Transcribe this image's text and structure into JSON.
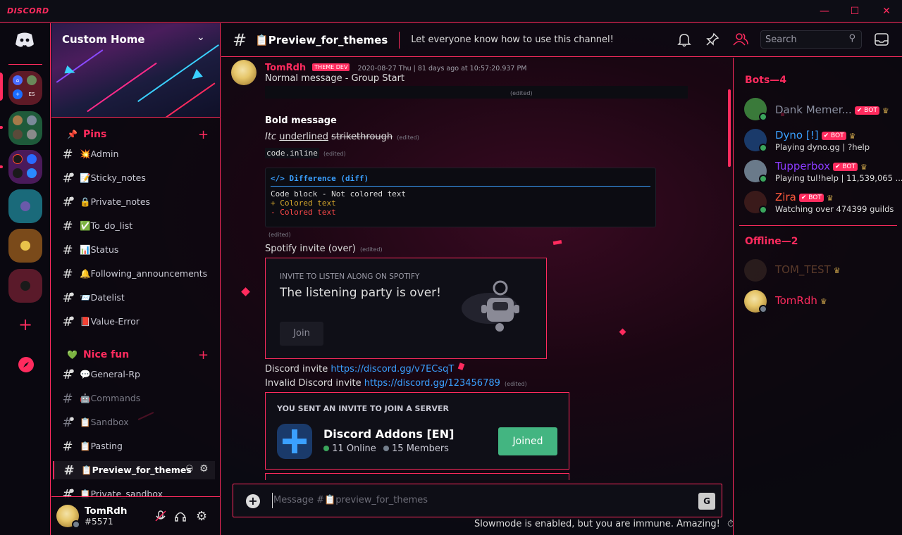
{
  "app": {
    "brand": "DISCORD"
  },
  "window": {
    "minimize": "—",
    "maximize": "☐",
    "close": "✕"
  },
  "server": {
    "name": "Custom Home"
  },
  "guild_mini": {
    "es": "ES"
  },
  "categories": [
    {
      "name": "Pins",
      "icon": "📌"
    },
    {
      "name": "Nice fun",
      "icon": "💚"
    }
  ],
  "channels_pins": [
    {
      "label": "💥Admin",
      "locked": false
    },
    {
      "label": "📝Sticky_notes",
      "locked": true
    },
    {
      "label": "🔒Private_notes",
      "locked": true
    },
    {
      "label": "✅To_do_list",
      "locked": false
    },
    {
      "label": "📊Status",
      "locked": false
    },
    {
      "label": "🔔Following_announcements",
      "locked": false
    },
    {
      "label": "📨Datelist",
      "locked": true
    },
    {
      "label": "📕Value-Error",
      "locked": true
    }
  ],
  "channels_fun": [
    {
      "label": "💬General-Rp",
      "locked": true
    },
    {
      "label": "🤖Commands",
      "locked": false
    },
    {
      "label": "📋Sandbox",
      "locked": true
    },
    {
      "label": "📋Pasting",
      "locked": false
    },
    {
      "label": "📋Preview_for_themes",
      "locked": false
    },
    {
      "label": "📋Private_sandbox",
      "locked": true
    }
  ],
  "user": {
    "name": "TomRdh",
    "discriminator": "#5571"
  },
  "header": {
    "channel": "📋Preview_for_themes",
    "topic": "Let everyone know how to use this channel!",
    "search_placeholder": "Search"
  },
  "message": {
    "author": "TomRdh",
    "tag": "THEME DEV",
    "timestamp": "2020-08-27 Thu | 81 days ago at 10:57:20.937 PM",
    "line1": "Normal message - Group Start",
    "edited": "(edited)",
    "bold": "Bold message",
    "italic": "Itc",
    "underline": "underlined",
    "strike": "strikethrough",
    "inline_code": "code.inline",
    "code_header": "</> Difference (diff)",
    "code_line1": "Code block - Not colored text",
    "code_line2": "+ Colored text",
    "code_line3": "- Colored text",
    "spotify_label": "Spotify invite (over)",
    "discord_invite_label": "Discord invite",
    "discord_invite_link": "https://discord.gg/v7ECsqT",
    "invalid_invite_label": "Invalid Discord invite",
    "invalid_invite_link": "https://discord.gg/123456789"
  },
  "spotify": {
    "heading": "INVITE TO LISTEN ALONG ON SPOTIFY",
    "title": "The listening party is over!",
    "button": "Join"
  },
  "invite": {
    "heading": "YOU SENT AN INVITE TO JOIN A SERVER",
    "server": "Discord Addons [EN]",
    "online": "11 Online",
    "members": "15 Members",
    "button": "Joined"
  },
  "composer": {
    "placeholder": "Message #📋preview_for_themes",
    "slowmode": "Slowmode is enabled, but you are immune. Amazing!"
  },
  "members": {
    "bots_header": "Bots—4",
    "offline_header": "Offline—2",
    "bots": [
      {
        "name": "Dank Memer...",
        "status": "",
        "color": "#8a8fa0"
      },
      {
        "name": "Dyno [!]",
        "status": "Playing dyno.gg | ?help",
        "color": "#3aa0ff"
      },
      {
        "name": "Tupperbox",
        "status": "Playing tul!help | 11,539,065 ...",
        "color": "#8c3cff"
      },
      {
        "name": "Zira",
        "status": "Watching over 474399 guilds",
        "color": "#ff5a3c"
      }
    ],
    "offline": [
      {
        "name": "TOM_TEST",
        "color": "#5a3a2a"
      },
      {
        "name": "TomRdh",
        "color": "#ff2b5e"
      }
    ],
    "bot_tag": "✔ BOT"
  },
  "colors": {
    "accent": "#ff2b5e",
    "link": "#3aa0ff",
    "online": "#3ba55c",
    "joined": "#43b581"
  }
}
